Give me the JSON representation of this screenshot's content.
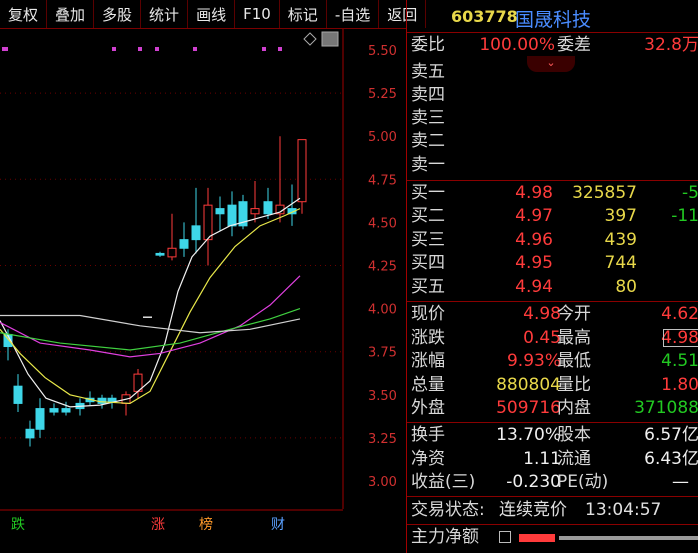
{
  "toolbar": {
    "buttons": [
      "复权",
      "叠加",
      "多股",
      "统计",
      "画线",
      "F10",
      "标记",
      "-自选",
      "返回"
    ]
  },
  "chart": {
    "y_ticks": [
      "5.50",
      "5.25",
      "5.00",
      "4.75",
      "4.50",
      "4.25",
      "4.00",
      "3.75",
      "3.50",
      "3.25",
      "3.00"
    ],
    "markers": [
      {
        "text": "跌",
        "color": "#22c922"
      },
      {
        "text": "涨",
        "color": "#ff3b3b"
      },
      {
        "text": "榜",
        "color": "#ff9a2a"
      },
      {
        "text": "财",
        "color": "#5aa0ff"
      }
    ],
    "colors": {
      "up": "#ff3b3b",
      "down": "#3ed6e8",
      "ma5": "#f0f0f0",
      "ma10": "#e8e84a",
      "ma20": "#e040e0",
      "ma30": "#40d040",
      "ma60": "#d0d0d0"
    }
  },
  "quote": {
    "code": "603778",
    "name": "国晟科技",
    "webi_label": "委比",
    "webi_value": "100.00%",
    "weicha_label": "委差",
    "weicha_value": "32.8万",
    "sell": [
      {
        "label": "卖五"
      },
      {
        "label": "卖四"
      },
      {
        "label": "卖三"
      },
      {
        "label": "卖二"
      },
      {
        "label": "卖一"
      }
    ],
    "buy": [
      {
        "label": "买一",
        "price": "4.98",
        "vol": "325857",
        "chg": "-5"
      },
      {
        "label": "买二",
        "price": "4.97",
        "vol": "397",
        "chg": "-11"
      },
      {
        "label": "买三",
        "price": "4.96",
        "vol": "439",
        "chg": ""
      },
      {
        "label": "买四",
        "price": "4.95",
        "vol": "744",
        "chg": ""
      },
      {
        "label": "买五",
        "price": "4.94",
        "vol": "80",
        "chg": ""
      }
    ],
    "stats": {
      "xianjia": {
        "label": "现价",
        "value": "4.98"
      },
      "jinkai": {
        "label": "今开",
        "value": "4.62"
      },
      "zhangdie": {
        "label": "涨跌",
        "value": "0.45"
      },
      "zuigao": {
        "label": "最高",
        "value": "4.98"
      },
      "zhangfu": {
        "label": "涨幅",
        "value": "9.93%"
      },
      "zuidi": {
        "label": "最低",
        "value": "4.51"
      },
      "zongliang": {
        "label": "总量",
        "value": "880804"
      },
      "liangbi": {
        "label": "量比",
        "value": "1.80"
      },
      "waipan": {
        "label": "外盘",
        "value": "509716"
      },
      "neipan": {
        "label": "内盘",
        "value": "371088"
      },
      "huanshou": {
        "label": "换手",
        "value": "13.70%"
      },
      "guben": {
        "label": "股本",
        "value": "6.57亿"
      },
      "jingzi": {
        "label": "净资",
        "value": "1.11"
      },
      "liutong": {
        "label": "流通",
        "value": "6.43亿"
      },
      "shouyi": {
        "label": "收益(三)",
        "value": "-0.230"
      },
      "pe": {
        "label": "PE(动)",
        "value": "—"
      }
    },
    "trade_status_label": "交易状态:",
    "trade_status": "连续竞价",
    "trade_time": "13:04:57",
    "main_net_label": "主力净额"
  }
}
